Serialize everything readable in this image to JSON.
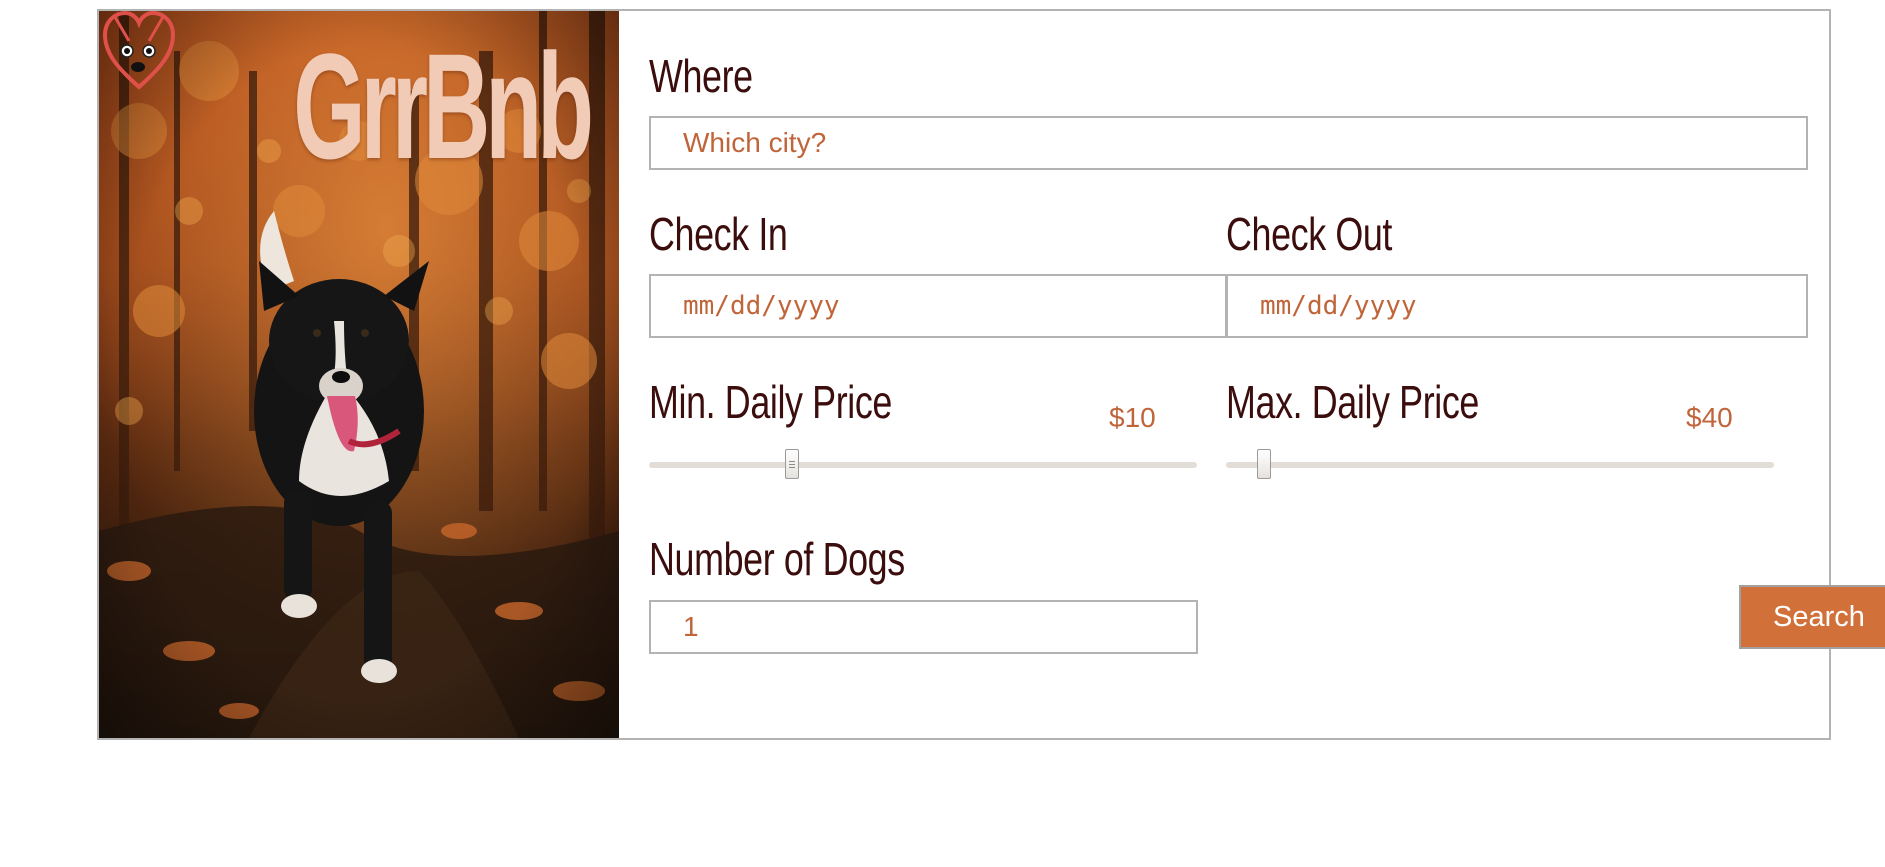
{
  "brand": {
    "name": "GrrBnb",
    "logo_icon": "dog-heart-logo-icon",
    "hero_image": "dog-running-in-autumn-forest"
  },
  "colors": {
    "label_text": "#3b0d0d",
    "accent": "#c0653a",
    "button_bg": "#d2703a",
    "brand_title": "#f1cbb6",
    "border": "#b3b3b3"
  },
  "form": {
    "where": {
      "label": "Where",
      "placeholder": "Which city?",
      "value": ""
    },
    "check_in": {
      "label": "Check In",
      "placeholder": "mm/dd/yyyy"
    },
    "check_out": {
      "label": "Check Out",
      "placeholder": "mm/dd/yyyy"
    },
    "min_price": {
      "label": "Min. Daily Price",
      "value_text": "$10",
      "value": 10
    },
    "max_price": {
      "label": "Max. Daily Price",
      "value_text": "$40",
      "value": 40
    },
    "dogs": {
      "label": "Number of Dogs",
      "value": "1"
    },
    "search_label": "Search"
  }
}
